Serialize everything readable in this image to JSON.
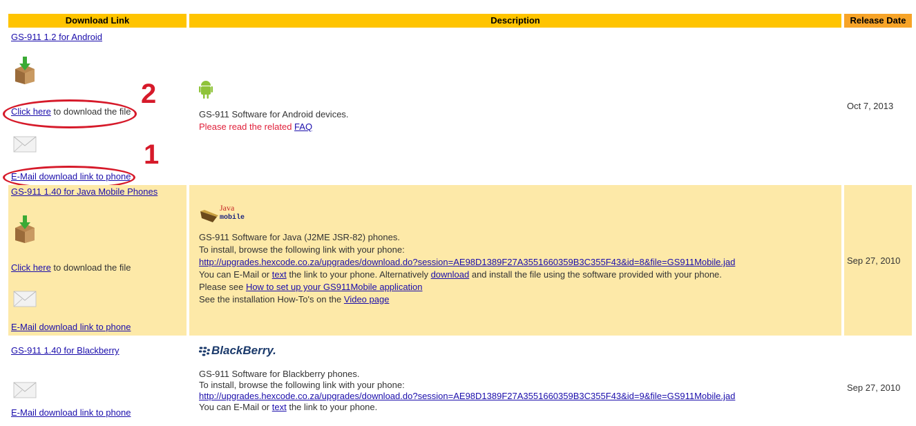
{
  "headers": {
    "download_link": "Download Link",
    "description": "Description",
    "release_date": "Release Date"
  },
  "rows": [
    {
      "title": "GS-911 1.2 for Android",
      "click_here": "Click here",
      "download_text": " to download the file",
      "email_link": "E-Mail download link to phone",
      "desc_line1": "GS-911 Software for Android devices.",
      "faq_prefix": "Please read the related ",
      "faq_link": "FAQ",
      "date": "Oct 7, 2013",
      "annotation_2": "2",
      "annotation_1": "1",
      "icon": "android-icon"
    },
    {
      "title": "GS-911 1.40 for Java Mobile Phones",
      "click_here": "Click here",
      "download_text": " to download the file",
      "email_link": "E-Mail download link to phone",
      "logo_top": "Java",
      "logo_bottom": "mobile",
      "desc_line1": "GS-911 Software for Java (J2ME JSR-82) phones.",
      "desc_line2": "To install, browse the following link with your phone:",
      "url": "http://upgrades.hexcode.co.za/upgrades/download.do?session=AE98D1389F27A3551660359B3C355F43&id=8&file=GS911Mobile.jad",
      "line4_a": "You can E-Mail or ",
      "line4_text_link": "text",
      "line4_b": " the link to your phone. Alternatively ",
      "line4_download_link": "download",
      "line4_c": " and install the file using the software provided with your phone.",
      "line5_a": "Please see ",
      "line5_link": "How to set up your GS911Mobile application",
      "line6_a": "See the installation How-To's on the ",
      "line6_link": "Video page",
      "date": "Sep 27, 2010"
    },
    {
      "title": "GS-911 1.40 for Blackberry",
      "email_link": "E-Mail download link to phone",
      "logo": "BlackBerry.",
      "desc_line1": "GS-911 Software for Blackberry phones.",
      "desc_line2": "To install, browse the following link with your phone:",
      "url": "http://upgrades.hexcode.co.za/upgrades/download.do?session=AE98D1389F27A3551660359B3C355F43&id=9&file=GS911Mobile.jad",
      "line4_a": "You can E-Mail or ",
      "line4_text_link": "text",
      "line4_b": " the link to your phone.",
      "date": "Sep 27, 2010"
    }
  ],
  "colors": {
    "header": "#ffc400",
    "header_date": "#f7a428",
    "alt_row": "#fde9a8",
    "link": "#1a0dab",
    "annotation": "#d61a2a"
  }
}
